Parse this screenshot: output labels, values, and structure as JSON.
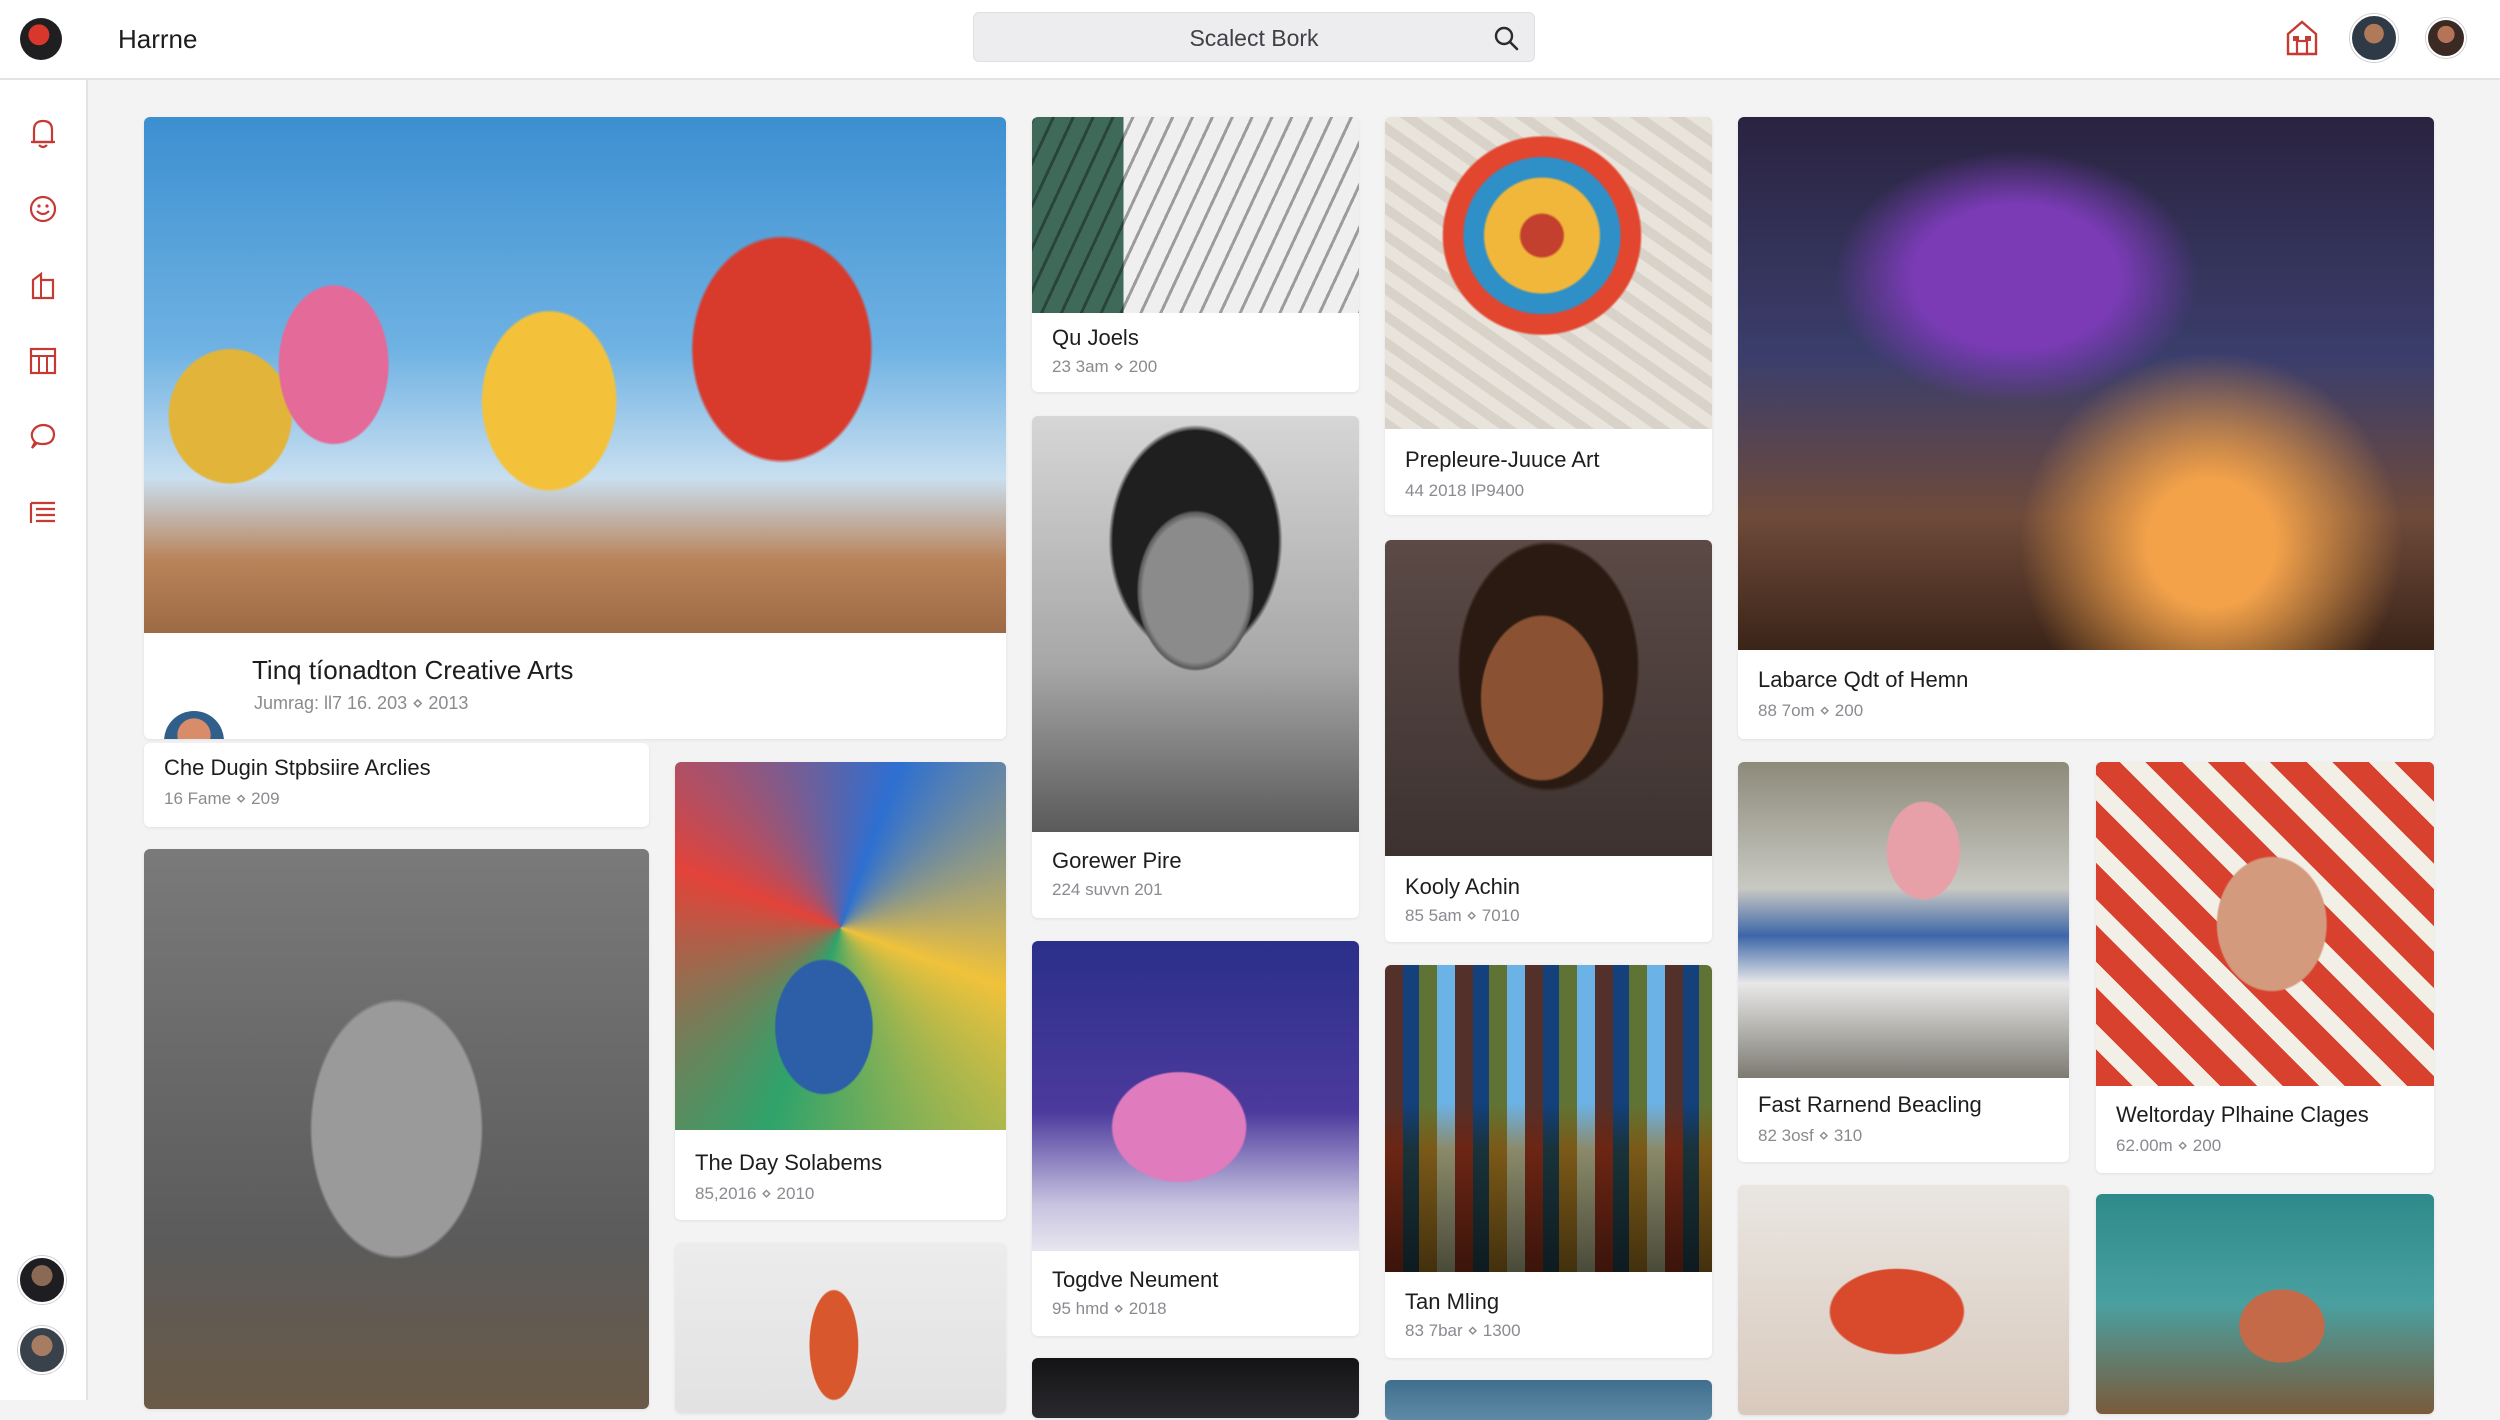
{
  "app": {
    "name": "Harrne"
  },
  "search": {
    "text": "Scalect Bork"
  },
  "icons": {
    "logo": "logo-mark",
    "search": "search-icon",
    "home": "home-icon",
    "sidebar": [
      "bell-icon",
      "smile-icon",
      "bookmark-icon",
      "grid-icon",
      "chat-icon",
      "list-icon"
    ]
  },
  "cards": [
    {
      "title": "Tinq tíonadton Creative Arts",
      "meta": "Jumrag: ll7 16. 203 ⋄ 2013"
    },
    {
      "title": "Che Dugin Stpbsiire Arclies",
      "meta": "16 Fame ⋄ 209"
    },
    {
      "title": "Qu Joels",
      "meta": "23 3am ⋄ 200"
    },
    {
      "title": "Gorewer Pire",
      "meta": "224 suvvn 201"
    },
    {
      "title": "Togdve Neument",
      "meta": "95 hmd ⋄ 2018"
    },
    {
      "title": "The Day Solabems",
      "meta": "85,2016 ⋄ 2010"
    },
    {
      "title": "Prepleure-Juuce Art",
      "meta": "44 2018 lP9400"
    },
    {
      "title": "Kooly Achin",
      "meta": "85 5am ⋄ 7010"
    },
    {
      "title": "Tan Mling",
      "meta": "83 7bar ⋄ 1300"
    },
    {
      "title": "Labarce Qdt of Hemn",
      "meta": "88 7om ⋄ 200"
    },
    {
      "title": "Fast Rarnend Beacling",
      "meta": "82 3osf ⋄ 310"
    },
    {
      "title": "Weltorday Plhaine Clages",
      "meta": "62.00m ⋄ 200"
    }
  ]
}
